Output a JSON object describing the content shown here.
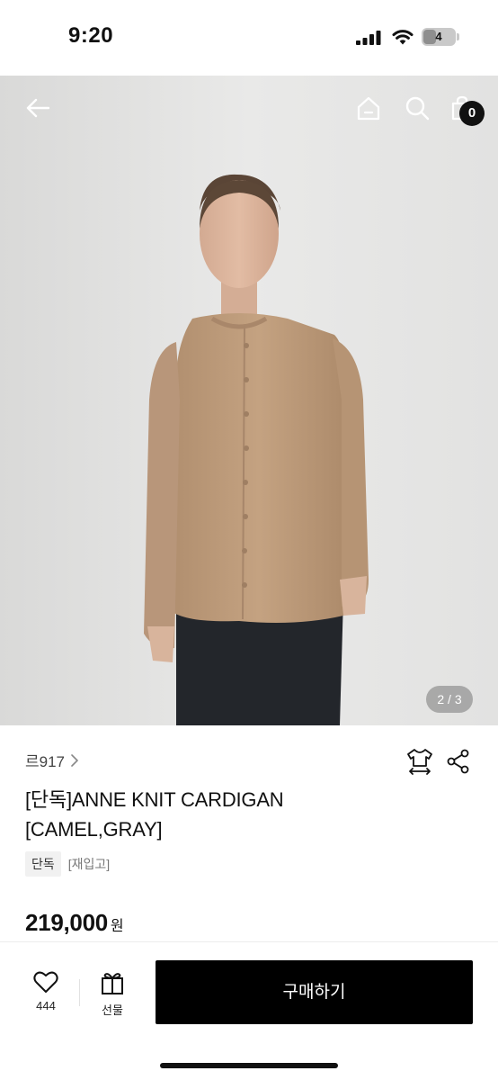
{
  "status_bar": {
    "time": "9:20",
    "battery": "4",
    "battery_level": 0.4
  },
  "hero": {
    "image": "model-wearing-camel-knit-cardigan",
    "page_indicator": "2 / 3",
    "cart_count": "0",
    "icons": {
      "back": "arrow-left-icon",
      "home": "home-icon",
      "search": "search-icon",
      "cart": "shopping-bag-icon"
    }
  },
  "product": {
    "brand": "르917",
    "title": "[단독]ANNE KNIT CARDIGAN [CAMEL,GRAY]",
    "tags": {
      "exclusive": "단독",
      "restock": "[재입고]"
    },
    "price": "219,000",
    "currency": "원",
    "icons": {
      "size_guide": "shirt-size-icon",
      "share": "share-icon",
      "brand_link": "chevron-right-icon"
    }
  },
  "bottom_bar": {
    "like_count": "444",
    "gift_label": "선물",
    "buy_label": "구매하기",
    "icons": {
      "like": "heart-icon",
      "gift": "gift-icon"
    }
  },
  "colors": {
    "primary": "#000000",
    "text": "#111111",
    "muted": "#777777",
    "badge": "#111111"
  }
}
